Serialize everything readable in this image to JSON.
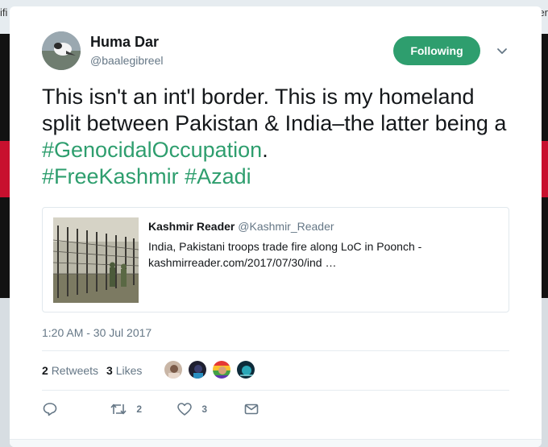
{
  "background": {
    "left_fragment": "ifi",
    "right_fragment": "er"
  },
  "tweet": {
    "author_name": "Huma Dar",
    "author_handle": "@baalegibreel",
    "follow_label": "Following",
    "text_plain_1": "This isn't an int'l border. This is my homeland split between Pakistan & India–the latter being a ",
    "tag_1": "#GenocidalOccupation",
    "text_plain_2": ".",
    "tag_2": "#FreeKashmir",
    "tag_3": "#Azadi",
    "timestamp": "1:20 AM - 30 Jul 2017"
  },
  "quote": {
    "name": "Kashmir Reader",
    "handle": "@Kashmir_Reader",
    "line_1": "India, Pakistani troops trade fire along LoC in Poonch -",
    "line_2": "kashmirreader.com/2017/07/30/ind …"
  },
  "stats": {
    "retweets_count": "2",
    "retweets_label": "Retweets",
    "likes_count": "3",
    "likes_label": "Likes"
  },
  "actions": {
    "reply_icon": "reply-icon",
    "retweet_icon": "retweet-icon",
    "retweet_count": "2",
    "like_icon": "heart-icon",
    "like_count": "3",
    "dm_icon": "envelope-icon"
  },
  "colors": {
    "accent": "#2e9e6e",
    "text": "#14171a",
    "muted": "#657786"
  }
}
